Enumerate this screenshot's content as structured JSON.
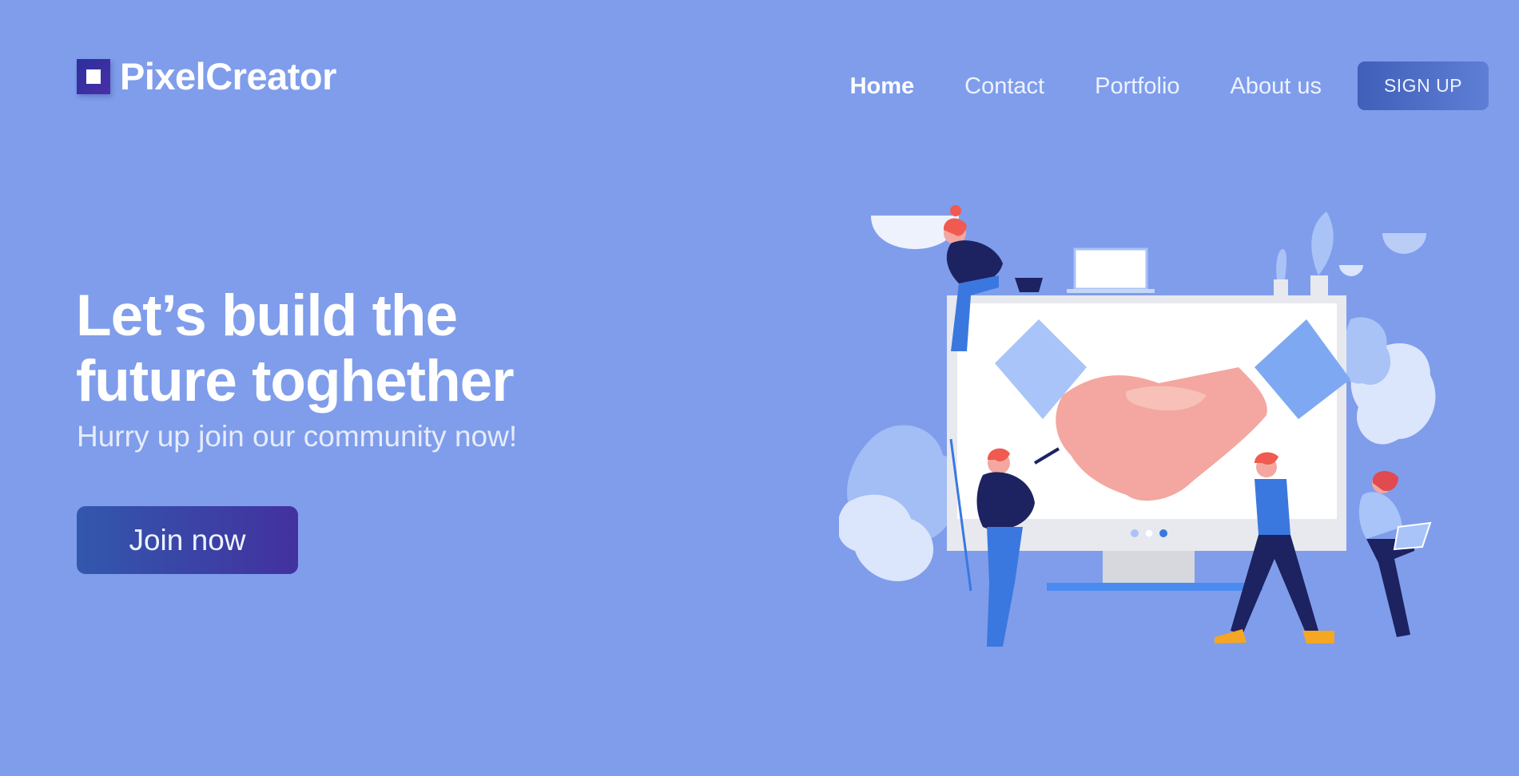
{
  "brand": {
    "name": "PixelCreator"
  },
  "nav": {
    "items": [
      {
        "label": "Home",
        "active": true
      },
      {
        "label": "Contact",
        "active": false
      },
      {
        "label": "Portfolio",
        "active": false
      },
      {
        "label": "About us",
        "active": false
      }
    ],
    "signup_label": "SIGN UP"
  },
  "hero": {
    "title_line1": "Let’s build the",
    "title_line2": "future toghether",
    "subtitle": "Hurry up join our community now!",
    "cta_label": "Join now"
  },
  "theme": {
    "background": "#7f9deb",
    "accent_start": "#3258ad",
    "accent_end": "#43319f",
    "logo_color": "#2b2f9b"
  },
  "illustration": {
    "icon": "handshake-team-illustration"
  }
}
